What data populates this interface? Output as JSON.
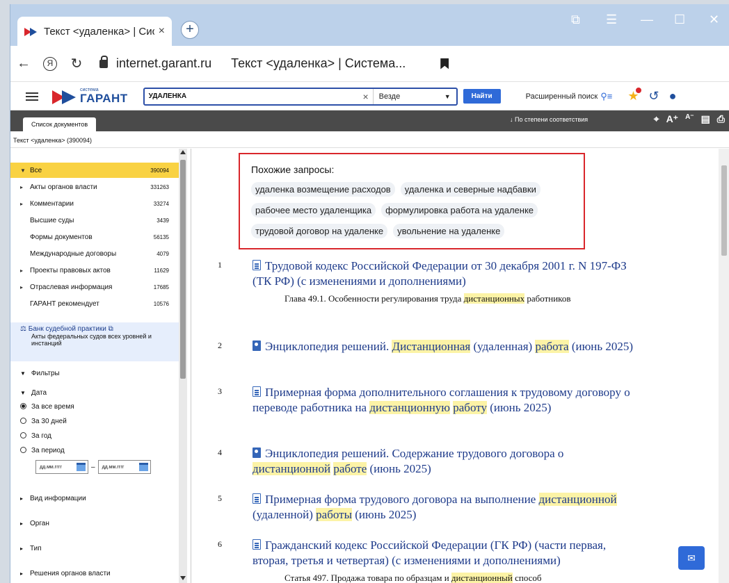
{
  "browser": {
    "tab_title": "Текст <удаленка> | Сис",
    "tab_close": "×",
    "new_tab": "+",
    "domain": "internet.garant.ru",
    "page_title": "Текст <удаленка> | Система...",
    "nav_back": "←",
    "nav_yandex": "Я",
    "nav_reload": "↻",
    "win_icons": [
      "⧉",
      "☰",
      "—",
      "☐",
      "✕"
    ]
  },
  "header": {
    "logo_small": "система",
    "logo_big": "ГАРАНТ",
    "search_value": "удаленка",
    "search_clear": "×",
    "scope": "Везде",
    "find_button": "Найти",
    "advanced_search": "Расширенный поиск"
  },
  "toolbar": {
    "tab_label": "Список документов",
    "sort_label": "↓  По степени соответствия",
    "font_up": "A⁺",
    "font_down": "A⁻"
  },
  "breadcrumb": "Текст <удаленка> (390094)",
  "categories": [
    {
      "label": "Все",
      "count": "390094",
      "arrow": "▼"
    },
    {
      "label": "Акты органов власти",
      "count": "331263",
      "arrow": "▸"
    },
    {
      "label": "Комментарии",
      "count": "33274",
      "arrow": "▸"
    },
    {
      "label": "Высшие суды",
      "count": "3439",
      "arrow": ""
    },
    {
      "label": "Формы документов",
      "count": "56135",
      "arrow": ""
    },
    {
      "label": "Международные договоры",
      "count": "4079",
      "arrow": ""
    },
    {
      "label": "Проекты правовых актов",
      "count": "11629",
      "arrow": "▸"
    },
    {
      "label": "Отраслевая информация",
      "count": "17685",
      "arrow": "▸"
    },
    {
      "label": "ГАРАНТ рекомендует",
      "count": "10576",
      "arrow": ""
    }
  ],
  "bank": {
    "title": "Банк судебной практики ⧉",
    "desc": "Акты федеральных судов всех уровней и инстанций"
  },
  "filters": {
    "title": "Фильтры",
    "date_title": "Дата",
    "options": [
      "За все время",
      "За 30 дней",
      "За год",
      "За период"
    ],
    "selected": "За все время",
    "date_placeholder": "дд.мм.гггг",
    "date_sep": "–",
    "groups": [
      "Вид информации",
      "Орган",
      "Тип",
      "Решения органов власти"
    ]
  },
  "similar": {
    "title": "Похожие запросы:",
    "chips": [
      "удаленка возмещение расходов",
      "удаленка и северные надбавки",
      "рабочее место удаленщика",
      "формулировка работа на удаленке",
      "трудовой договор на удаленке",
      "увольнение на удаленке"
    ]
  },
  "results": [
    {
      "num": "1",
      "t1": "Трудовой кодекс Российской Федерации от 30 декабря 2001 г. N 197-ФЗ (ТК РФ) (с изменениями и дополнениями)",
      "sub_a": "Глава 49.1. Особенности регулирования труда ",
      "sub_hl": "дистанционных",
      "sub_b": " работников"
    },
    {
      "num": "2",
      "t_a": "Энциклопедия решений. ",
      "t_hl1": "Дистанционная",
      "t_b": " (удаленная) ",
      "t_hl2": "работа",
      "t_c": " (июнь 2025)"
    },
    {
      "num": "3",
      "t_a": "Примерная форма дополнительного соглашения к трудовому договору о переводе работника на ",
      "t_hl1": "дистанционную",
      "t_b": " ",
      "t_hl2": "работу",
      "t_c": " (июнь 2025)"
    },
    {
      "num": "4",
      "t_a": "Энциклопедия решений. Содержание трудового договора о ",
      "t_hl1": "дистанционной",
      "t_b": " ",
      "t_hl2": "работе",
      "t_c": " (июнь 2025)"
    },
    {
      "num": "5",
      "t_a": "Примерная форма трудового договора на выполнение ",
      "t_hl1": "дистанционной",
      "t_b": " (удаленной) ",
      "t_hl2": "работы",
      "t_c": " (июнь 2025)"
    },
    {
      "num": "6",
      "t1": "Гражданский кодекс Российской Федерации (ГК РФ) (части первая, вторая, третья и четвертая) (с изменениями и дополнениями)",
      "sub_a": "Статья 497. Продажа товара по образцам и ",
      "sub_hl": "дистанционный",
      "sub_b": " способ"
    }
  ]
}
